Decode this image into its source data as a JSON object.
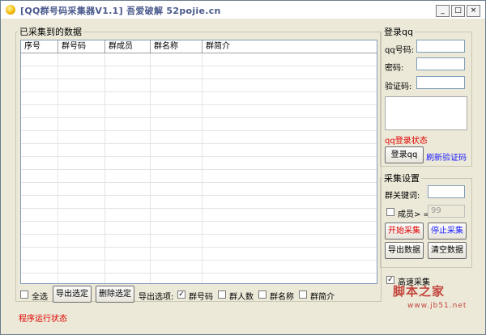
{
  "window": {
    "title": "[QQ群号码采集器V1.1]  吾爱破解 52pojie.cn",
    "controls": {
      "minimize": "_",
      "maximize": "□",
      "close": "×"
    }
  },
  "collected": {
    "legend": "已采集到的数据",
    "columns": [
      "序号",
      "群号码",
      "群成员",
      "群名称",
      "群简介"
    ],
    "rows": []
  },
  "bottom_bar": {
    "select_all": {
      "label": "全选",
      "checked": false
    },
    "export_selected": "导出选定",
    "delete_selected": "删除选定",
    "export_options_label": "导出选项:",
    "options": [
      {
        "label": "群号码",
        "checked": true
      },
      {
        "label": "群人数",
        "checked": false
      },
      {
        "label": "群名称",
        "checked": false
      },
      {
        "label": "群简介",
        "checked": false
      }
    ],
    "run_status": "程序运行状态"
  },
  "login": {
    "legend": "登录qq",
    "qq_label": "qq号码:",
    "password_label": "密码:",
    "captcha_label": "验证码:",
    "status": "qq登录状态",
    "login_button": "登录qq",
    "refresh_captcha": "刷新验证码"
  },
  "settings": {
    "legend": "采集设置",
    "keyword_label": "群关键词:",
    "member_label": "成员> =",
    "member_checked": false,
    "member_value": "99",
    "start_button": "开始采集",
    "stop_button": "停止采集",
    "export_button": "导出数据",
    "clear_button": "清空数据",
    "fast_collect": {
      "label": "高速采集",
      "checked": true
    }
  },
  "watermark": {
    "main": "脚本之家",
    "sub": "www.jb51.net"
  },
  "colors": {
    "red_text": "#e00000",
    "blue_text": "#1a1aff",
    "border": "#7f9db9"
  }
}
